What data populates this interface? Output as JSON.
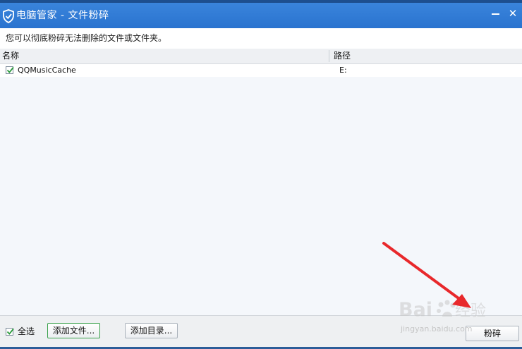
{
  "window": {
    "title": "电脑管家 - 文件粉碎",
    "close_glyph": "✕"
  },
  "description": "您可以彻底粉碎无法删除的文件或文件夹。",
  "list": {
    "columns": [
      "名称",
      "路径"
    ],
    "rows": [
      {
        "name": "QQMusicCache",
        "path": "E:",
        "checked": true
      }
    ]
  },
  "footer": {
    "select_all_label": "全选",
    "select_all_checked": true,
    "add_file_label": "添加文件...",
    "add_dir_label": "添加目录...",
    "shred_label": "粉碎"
  },
  "watermark": {
    "text": "Baidu经验",
    "sub": "jingyan.baidu.com"
  },
  "colors": {
    "titlebar": "#2a73cf",
    "accent_green": "#38a04a",
    "arrow_red": "#e8282b"
  },
  "icons": {
    "app": "shield-icon",
    "close": "close-icon",
    "minimize": "minimize-icon",
    "check": "checkmark-icon"
  }
}
